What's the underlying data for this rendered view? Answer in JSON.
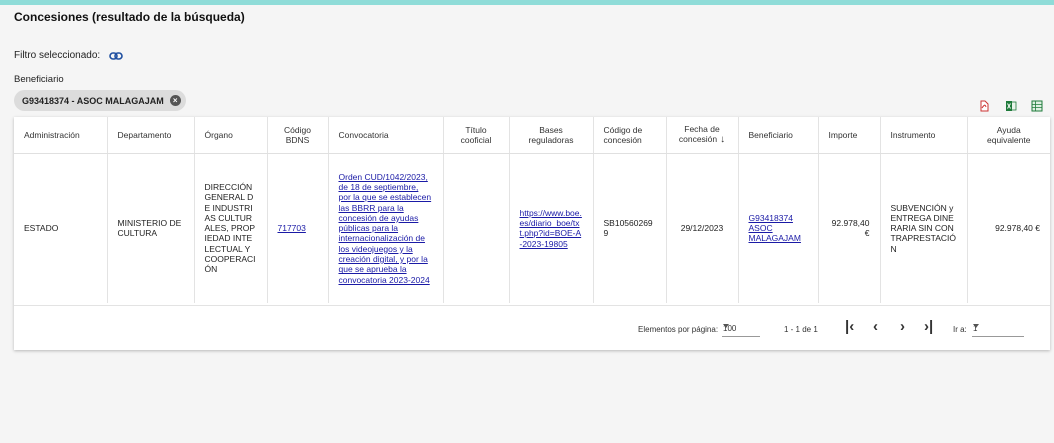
{
  "header": {
    "title": "Concesiones (resultado de la búsqueda)"
  },
  "filter": {
    "label": "Filtro seleccionado:",
    "icon": "link-icon"
  },
  "beneficiary": {
    "label": "Beneficiario",
    "chip_label": "G93418374 - ASOC MALAGAJAM"
  },
  "exports": [
    "pdf-export-icon",
    "excel-export-icon",
    "csv-export-icon"
  ],
  "table": {
    "headers": {
      "administracion": "Administración",
      "departamento": "Departamento",
      "organo": "Órgano",
      "codigo_bdns_1": "Código",
      "codigo_bdns_2": "BDNS",
      "convocatoria": "Convocatoria",
      "titulo_1": "Título",
      "titulo_2": "cooficial",
      "bases_1": "Bases",
      "bases_2": "reguladoras",
      "codigo_concesion_1": "Código de",
      "codigo_concesion_2": "concesión",
      "fecha_1": "Fecha de",
      "fecha_2": "concesión",
      "fecha_sort": "↓",
      "beneficiario": "Beneficiario",
      "importe": "Importe",
      "instrumento": "Instrumento",
      "ayuda_1": "Ayuda",
      "ayuda_2": "equivalente"
    },
    "row": {
      "administracion": "ESTADO",
      "departamento": "MINISTERIO DE CULTURA",
      "organo": "DIRECCIÓN GENERAL DE INDUSTRIAS CULTURALES, PROPIEDAD INTELECTUAL Y COOPERACIÓN",
      "codigo_bdns": "717703",
      "convocatoria": "Orden CUD/1042/2023, de 18 de septiembre, por la que se establecen las BBRR para la concesión de ayudas públicas para la internacionalización de los videojuegos y la creación digital, y por la que se aprueba la convocatoria 2023-2024",
      "titulo_cooficial": "",
      "bases_reguladoras": "https://www.boe.es/diario_boe/txt.php?id=BOE-A-2023-19805",
      "codigo_concesion": "SB105602699",
      "fecha_concesion": "29/12/2023",
      "beneficiario": "G93418374 ASOC MALAGAJAM",
      "importe": "92.978,40 €",
      "instrumento": "SUBVENCIÓN y ENTREGA DINERARIA SIN CONTRAPRESTACIÓN",
      "ayuda_equivalente": "92.978,40 €"
    }
  },
  "pager": {
    "items_label": "Elementos por página:",
    "items_value": "100",
    "range": "1 - 1 de 1",
    "goto_label": "Ir a:",
    "goto_value": "1"
  }
}
